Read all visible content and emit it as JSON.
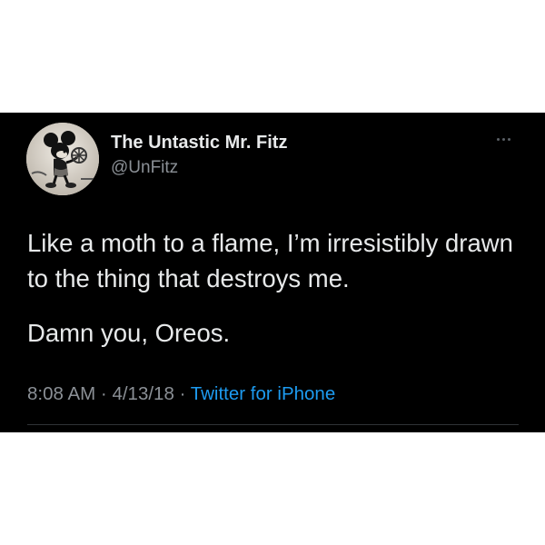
{
  "tweet": {
    "display_name": "The Untastic Mr. Fitz",
    "handle": "@UnFitz",
    "body_line1": "Like a moth to a flame, I’m irresistibly drawn to the thing that destroys me.",
    "body_line2": "Damn you, Oreos.",
    "time": "8:08 AM",
    "separator": "·",
    "date": "4/13/18",
    "source": "Twitter for iPhone"
  },
  "icons": {
    "more": "more-horizontal-icon",
    "avatar": "cartoon-mouse-avatar"
  },
  "colors": {
    "background": "#000000",
    "text": "#e7e9ea",
    "secondary": "#8b9096",
    "link": "#1d9bf0"
  }
}
